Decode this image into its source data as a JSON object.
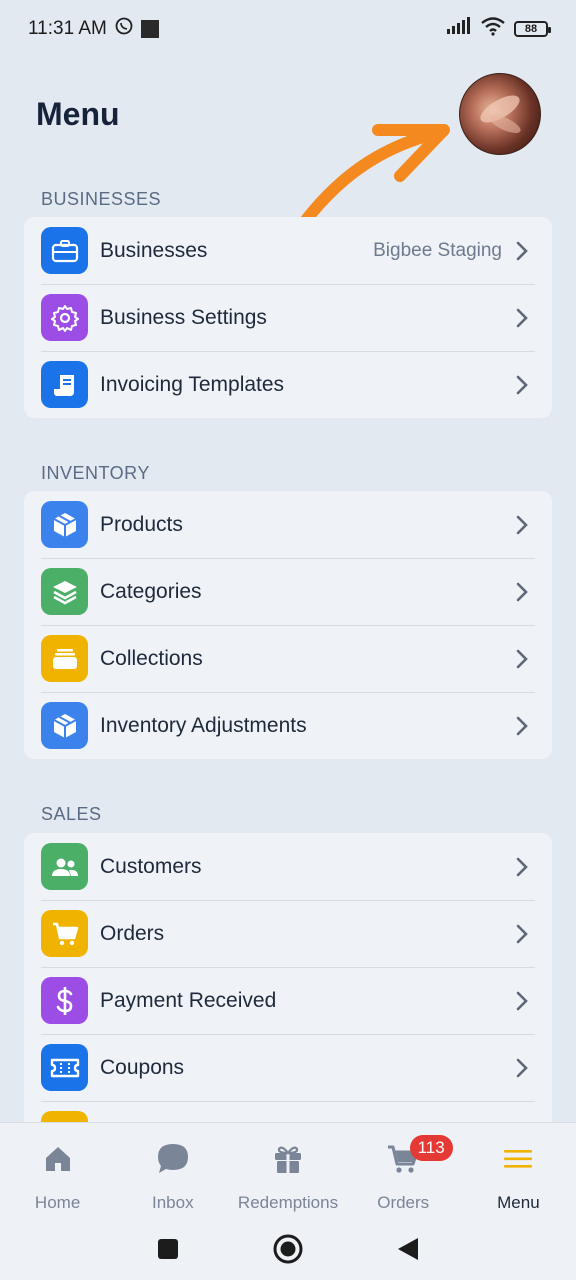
{
  "status": {
    "time": "11:31 AM",
    "battery": "88"
  },
  "header": {
    "title": "Menu"
  },
  "sections": {
    "businesses": {
      "label": "BUSINESSES",
      "items": [
        {
          "label": "Businesses",
          "value": "Bigbee Staging",
          "icon": "briefcase-icon",
          "color": "#1a73e8"
        },
        {
          "label": "Business Settings",
          "icon": "gear-icon",
          "color": "#9b4de6"
        },
        {
          "label": "Invoicing Templates",
          "icon": "document-icon",
          "color": "#1a73e8"
        }
      ]
    },
    "inventory": {
      "label": "INVENTORY",
      "items": [
        {
          "label": "Products",
          "icon": "box-icon",
          "color": "#3c82ec"
        },
        {
          "label": "Categories",
          "icon": "layers-icon",
          "color": "#4caf68"
        },
        {
          "label": "Collections",
          "icon": "collection-icon",
          "color": "#f0b400"
        },
        {
          "label": "Inventory Adjustments",
          "icon": "box-icon",
          "color": "#3c82ec"
        }
      ]
    },
    "sales": {
      "label": "SALES",
      "items": [
        {
          "label": "Customers",
          "icon": "users-icon",
          "color": "#4caf68"
        },
        {
          "label": "Orders",
          "icon": "cart-icon",
          "color": "#f0b400"
        },
        {
          "label": "Payment Received",
          "icon": "dollar-icon",
          "color": "#9b4de6"
        },
        {
          "label": "Coupons",
          "icon": "ticket-icon",
          "color": "#1a73e8"
        }
      ]
    }
  },
  "bottom_nav": [
    {
      "label": "Home",
      "icon": "home-icon"
    },
    {
      "label": "Inbox",
      "icon": "chat-icon"
    },
    {
      "label": "Redemptions",
      "icon": "gift-icon"
    },
    {
      "label": "Orders",
      "icon": "cart-icon",
      "badge": "113"
    },
    {
      "label": "Menu",
      "icon": "menu-icon",
      "active": true
    }
  ],
  "accent": "#f4891f"
}
